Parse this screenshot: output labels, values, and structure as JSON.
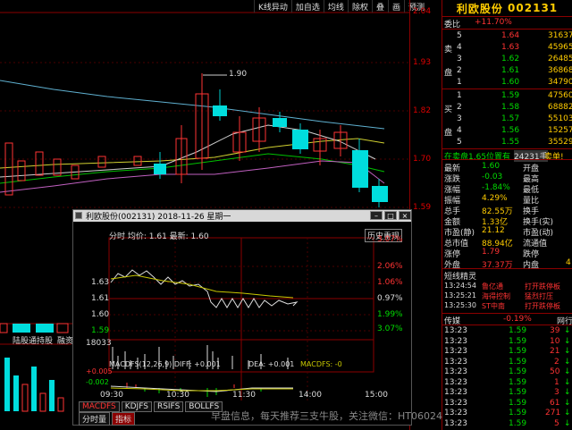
{
  "toolbar": {
    "items": [
      "K线异动",
      "加自选",
      "均线",
      "除权",
      "叠",
      "画",
      "预测"
    ]
  },
  "price_axis": {
    "labels": [
      "2.04",
      "1.93",
      "1.82",
      "1.70",
      "1.59"
    ]
  },
  "kline": {
    "high_mark": "1.90",
    "bottom_tabs": [
      "陆股通持股",
      "融资"
    ]
  },
  "stock": {
    "name": "利欧股份",
    "code": "002131"
  },
  "orderbook": {
    "weibi_label": "委比",
    "weibi_value": "+11.70%",
    "sell_label": "卖盘",
    "buy_label": "买盘",
    "sells": [
      {
        "lvl": "5",
        "price": "1.64",
        "vol": "31637"
      },
      {
        "lvl": "4",
        "price": "1.63",
        "vol": "45965"
      },
      {
        "lvl": "3",
        "price": "1.62",
        "vol": "26485"
      },
      {
        "lvl": "2",
        "price": "1.61",
        "vol": "36868"
      },
      {
        "lvl": "1",
        "price": "1.60",
        "vol": "34790"
      }
    ],
    "buys": [
      {
        "lvl": "1",
        "price": "1.59",
        "vol": "47560"
      },
      {
        "lvl": "2",
        "price": "1.58",
        "vol": "68882"
      },
      {
        "lvl": "3",
        "price": "1.57",
        "vol": "55103"
      },
      {
        "lvl": "4",
        "price": "1.56",
        "vol": "15257"
      },
      {
        "lvl": "5",
        "price": "1.55",
        "vol": "35529"
      }
    ],
    "status_left": "在卖盘1.65位置有",
    "status_mid": "24231手",
    "status_right": "卖单!"
  },
  "quote": {
    "rows": [
      {
        "l": "最新",
        "lv": "1.60",
        "r": "开盘",
        "rv": ""
      },
      {
        "l": "涨跌",
        "lv": "-0.03",
        "r": "最高",
        "rv": ""
      },
      {
        "l": "涨幅",
        "lv": "-1.84%",
        "r": "最低",
        "rv": ""
      },
      {
        "l": "振幅",
        "lv": "4.29%",
        "r": "量比",
        "rv": ""
      },
      {
        "l": "总手",
        "lv": "82.55万",
        "r": "换手",
        "rv": ""
      },
      {
        "l": "金额",
        "lv": "1.33亿",
        "r": "换手(实)",
        "rv": ""
      },
      {
        "l": "市盈(静)",
        "lv": "21.12",
        "r": "市盈(动)",
        "rv": ""
      },
      {
        "l": "总市值",
        "lv": "88.94亿",
        "r": "流通值",
        "rv": ""
      },
      {
        "l": "涨停",
        "lv": "1.79",
        "r": "跌停",
        "rv": ""
      },
      {
        "l": "外盘",
        "lv": "37.37万",
        "r": "内盘",
        "rv": "4"
      }
    ]
  },
  "events": {
    "title": "短线精灵",
    "rows": [
      {
        "time": "13:24:54",
        "tag": "鲁亿通",
        "desc": "打开跌停板"
      },
      {
        "time": "13:25:21",
        "tag": "海得控制",
        "desc": "猛烈打压"
      },
      {
        "time": "13:25:30",
        "tag": "ST中南",
        "desc": "打开跌停板"
      }
    ]
  },
  "ticks": {
    "header_left": "传媒",
    "header_mid": "-0.19%",
    "header_right": "网行",
    "rows": [
      {
        "time": "13:23",
        "price": "1.59",
        "vol": "39",
        "dir": "down"
      },
      {
        "time": "13:23",
        "price": "1.59",
        "vol": "10",
        "dir": "down"
      },
      {
        "time": "13:23",
        "price": "1.59",
        "vol": "21",
        "dir": "down"
      },
      {
        "time": "13:23",
        "price": "1.59",
        "vol": "2",
        "dir": "down"
      },
      {
        "time": "13:23",
        "price": "1.59",
        "vol": "50",
        "dir": "down"
      },
      {
        "time": "13:23",
        "price": "1.59",
        "vol": "1",
        "dir": "down"
      },
      {
        "time": "13:23",
        "price": "1.59",
        "vol": "3",
        "dir": "down"
      },
      {
        "time": "13:23",
        "price": "1.59",
        "vol": "61",
        "dir": "down"
      },
      {
        "time": "13:23",
        "price": "1.59",
        "vol": "271",
        "dir": "down"
      },
      {
        "time": "13:23",
        "price": "1.59",
        "vol": "5",
        "dir": "down"
      }
    ]
  },
  "popup": {
    "title": "利欧股份(002131) 2018-11-26 星期一",
    "label_ft": "分时 均价: 1.61 最新: 1.60",
    "history_btn": "历史重现",
    "price_labels": [
      "1.63",
      "1.61",
      "1.60",
      "1.59"
    ],
    "pct_labels": [
      "3.07%",
      "2.06%",
      "1.06%",
      "0.97%",
      "1.99%",
      "3.07%"
    ],
    "vol_label": "18033",
    "macd_label": "MACDFS(12,26,9) DIFF: +0.001",
    "macd_dea": "DEA: +0.001",
    "macd_val": "MACDFS: -0",
    "macd_levels": [
      "+0.005",
      "-0.002"
    ],
    "times": [
      "09:30",
      "10:30",
      "11:30",
      "14:00",
      "15:00"
    ],
    "tabs": [
      "MACDFS",
      "KDJFS",
      "RSIFS",
      "BOLLFS"
    ],
    "tabs2": [
      "分时量",
      "指标"
    ]
  },
  "watermark": "早盘信息，每天推荐三支牛股，关注微信：HT06024",
  "colors": {
    "up": "#ff3333",
    "down": "#00dddd",
    "axis": "#8b0000",
    "name": "#ffcc00"
  }
}
